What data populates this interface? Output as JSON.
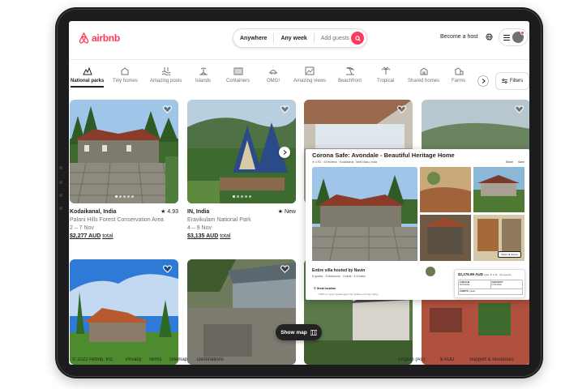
{
  "header": {
    "logo_text": "airbnb",
    "search": {
      "anywhere": "Anywhere",
      "any_week": "Any week",
      "add_guests": "Add guests"
    },
    "become_host": "Become a host"
  },
  "categories": [
    {
      "label": "National parks",
      "icon": "national-park-icon",
      "active": true
    },
    {
      "label": "Tiny homes",
      "icon": "tiny-home-icon"
    },
    {
      "label": "Amazing pools",
      "icon": "pool-icon"
    },
    {
      "label": "Islands",
      "icon": "island-icon"
    },
    {
      "label": "Containers",
      "icon": "container-icon"
    },
    {
      "label": "OMG!",
      "icon": "omg-icon"
    },
    {
      "label": "Amazing views",
      "icon": "view-icon"
    },
    {
      "label": "Beachfront",
      "icon": "beach-icon"
    },
    {
      "label": "Tropical",
      "icon": "palm-icon"
    },
    {
      "label": "Shared homes",
      "icon": "shared-home-icon"
    },
    {
      "label": "Farms",
      "icon": "farm-icon"
    }
  ],
  "filters_label": "Filters",
  "listings": [
    {
      "title": "Kodaikanal, India",
      "rating": "4.93",
      "subtitle": "Palani Hills Forest Conservation Area",
      "dates": "2 – 7 Nov",
      "price": "$2,277 AUD",
      "total": "total"
    },
    {
      "title": "IN, India",
      "rating": "New",
      "subtitle": "Eravikulam National Park",
      "dates": "4 – 9 Nov",
      "price": "$3,135 AUD",
      "total": "total"
    }
  ],
  "popup": {
    "title": "Corona Safe: Avondale - Beautiful Heritage Home",
    "meta": "★ 4.93 · 44 reviews · Kodaikanal, Tamil Nadu, India",
    "share": "Share",
    "save": "Save",
    "show_all": "Show all photos",
    "hosted_by": "Entire villa hosted by Navin",
    "details": "8 guests · 4 bedrooms · 4 beds · 4.5 baths",
    "location": "Great location",
    "location_sub": "100% of recent guests gave the location a 5-star rating.",
    "booking": {
      "price": "$2,276.89 AUD",
      "per": "total",
      "rating": "★ 4.93 · 44 reviews",
      "checkin_label": "CHECK-IN",
      "checkin": "02/11/2022",
      "checkout_label": "CHECKOUT",
      "checkout": "07/11/2022",
      "guests_label": "GUESTS",
      "guests": "1 guest"
    }
  },
  "show_map": "Show map",
  "footer": {
    "copyright": "© 2022 Airbnb, Inc.",
    "links": [
      "Privacy",
      "Terms",
      "Sitemap",
      "Destinations"
    ],
    "language": "English (AU)",
    "currency": "$ AUD",
    "support": "Support & resources"
  }
}
